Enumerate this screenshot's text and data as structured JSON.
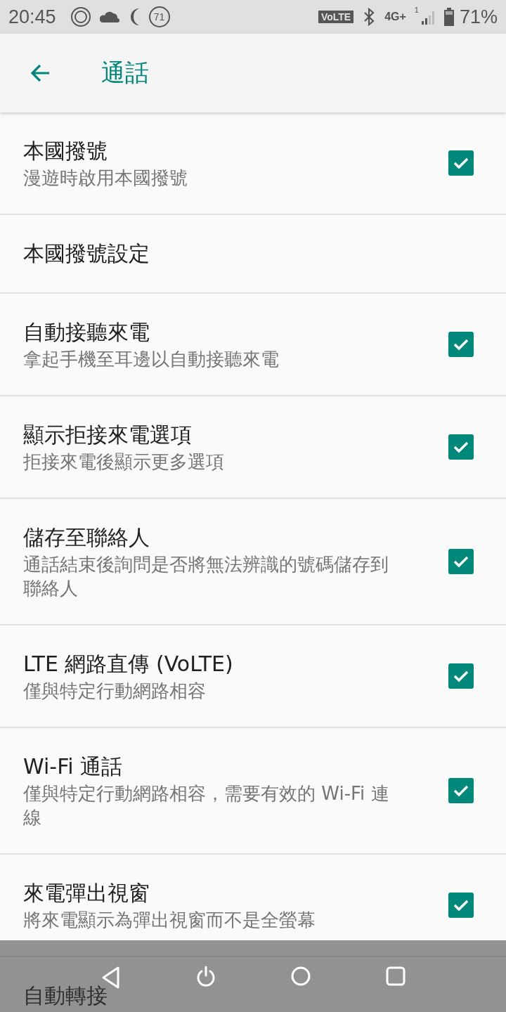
{
  "status_bar": {
    "time": "20:45",
    "aqi": "71",
    "volte": "VoLTE",
    "network": "4G+",
    "sim": "1",
    "battery": "71%"
  },
  "app_bar": {
    "title": "通話"
  },
  "items": [
    {
      "kind": "checkbox",
      "title": "本國撥號",
      "summary": "漫遊時啟用本國撥號",
      "checked": true
    },
    {
      "kind": "link",
      "title": "本國撥號設定"
    },
    {
      "kind": "checkbox",
      "title": "自動接聽來電",
      "summary": "拿起手機至耳邊以自動接聽來電",
      "checked": true
    },
    {
      "kind": "checkbox",
      "title": "顯示拒接來電選項",
      "summary": "拒接來電後顯示更多選項",
      "checked": true
    },
    {
      "kind": "checkbox",
      "title": "儲存至聯絡人",
      "summary": "通話結束後詢問是否將無法辨識的號碼儲存到聯絡人",
      "checked": true
    },
    {
      "kind": "checkbox",
      "title": "LTE 網路直傳 (VoLTE)",
      "summary": "僅與特定行動網路相容",
      "checked": true
    },
    {
      "kind": "checkbox",
      "title": "Wi-Fi 通話",
      "summary": "僅與特定行動網路相容，需要有效的 Wi-Fi 連線",
      "checked": true
    },
    {
      "kind": "checkbox",
      "title": "來電彈出視窗",
      "summary": "將來電顯示為彈出視窗而不是全螢幕",
      "checked": true
    },
    {
      "kind": "link",
      "title": "自動轉接"
    }
  ]
}
